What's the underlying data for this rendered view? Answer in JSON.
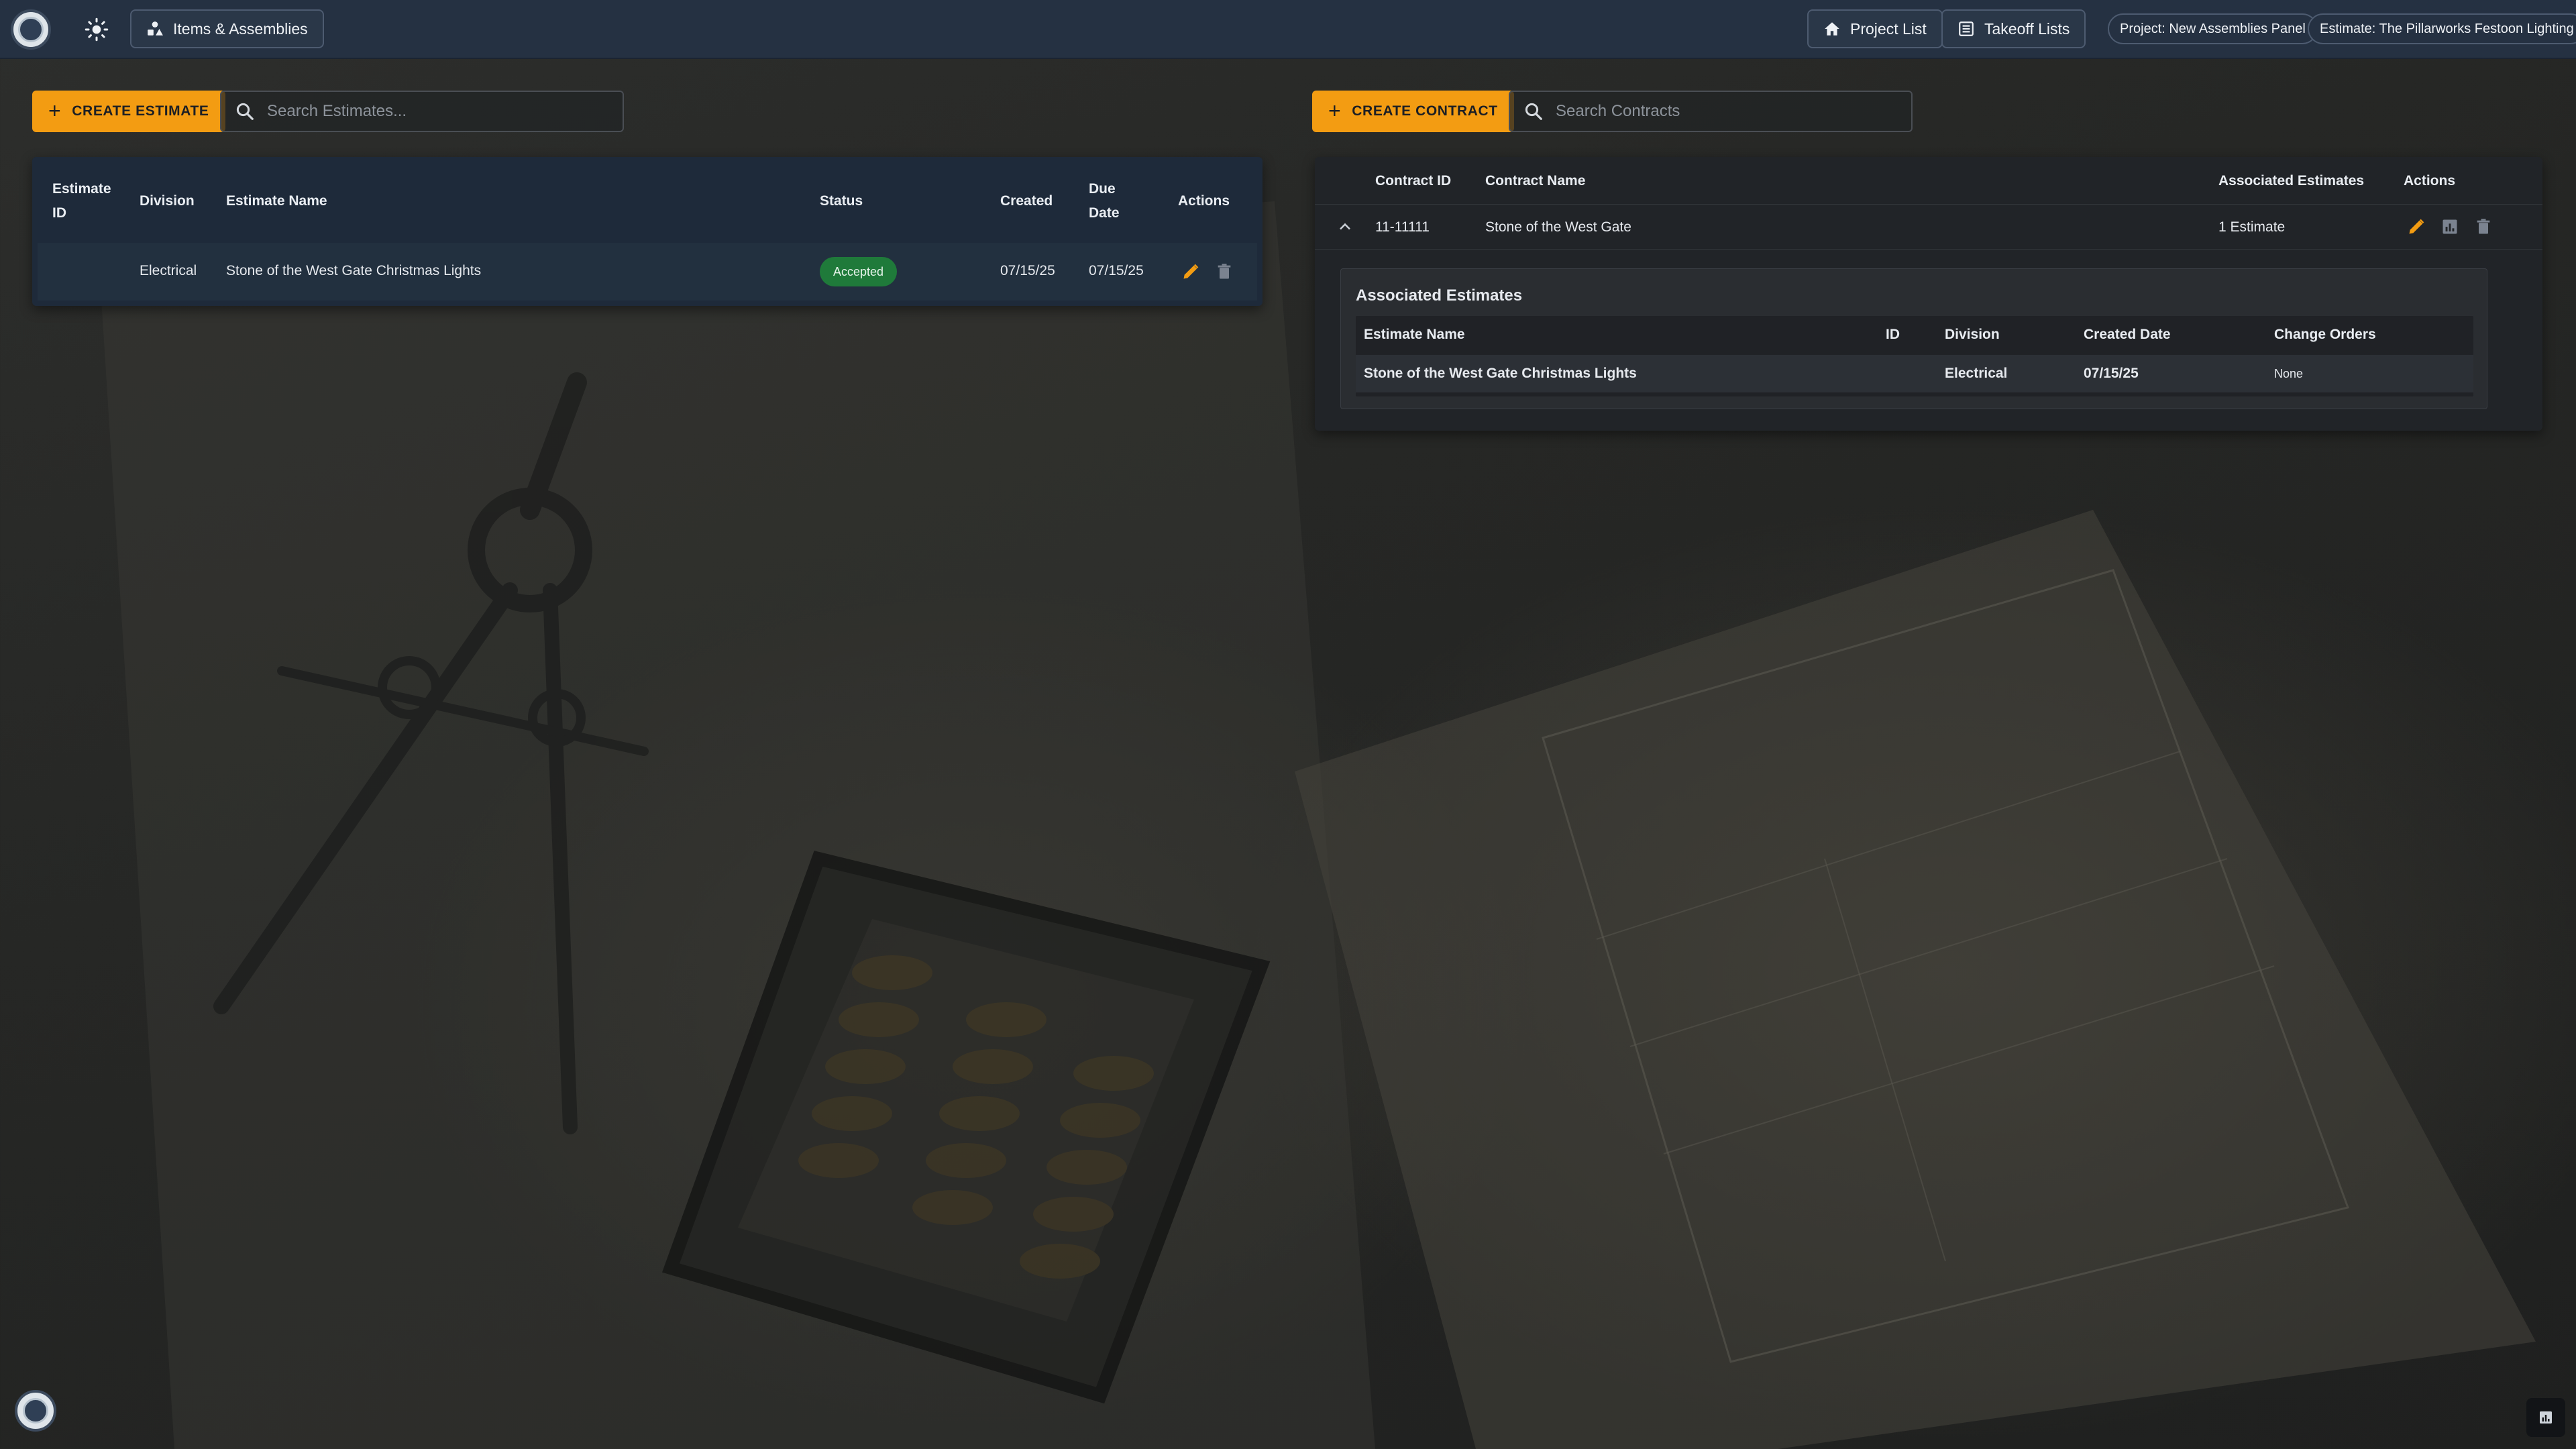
{
  "topbar": {
    "items_assemblies_label": "Items & Assemblies",
    "project_list_label": "Project List",
    "takeoff_lists_label": "Takeoff Lists",
    "project_pill": "Project: New Assemblies Panel",
    "estimate_pill": "Estimate: The Pillarworks Festoon Lighting"
  },
  "estimates": {
    "create_label": "CREATE ESTIMATE",
    "search_placeholder": "Search Estimates...",
    "headers": {
      "estimate_id_1": "Estimate",
      "estimate_id_2": "ID",
      "division": "Division",
      "estimate_name": "Estimate Name",
      "status": "Status",
      "created": "Created",
      "due_date_1": "Due",
      "due_date_2": "Date",
      "actions": "Actions"
    },
    "rows": [
      {
        "estimate_id": "",
        "division": "Electrical",
        "estimate_name": "Stone of the West Gate Christmas Lights",
        "status": "Accepted",
        "created": "07/15/25",
        "due_date": "07/15/25"
      }
    ]
  },
  "contracts": {
    "create_label": "CREATE CONTRACT",
    "search_placeholder": "Search Contracts",
    "headers": {
      "contract_id": "Contract ID",
      "contract_name": "Contract Name",
      "associated_estimates": "Associated Estimates",
      "actions": "Actions"
    },
    "rows": [
      {
        "contract_id": "11-11111",
        "contract_name": "Stone of the West Gate",
        "associated_estimates": "1 Estimate",
        "expanded": true
      }
    ],
    "associated": {
      "title": "Associated Estimates",
      "headers": {
        "estimate_name": "Estimate Name",
        "id": "ID",
        "division": "Division",
        "created_date": "Created Date",
        "change_orders": "Change Orders"
      },
      "rows": [
        {
          "estimate_name": "Stone of the West Gate Christmas Lights",
          "id": "",
          "division": "Electrical",
          "created_date": "07/15/25",
          "change_orders": "None"
        }
      ]
    }
  },
  "colors": {
    "accent": "#f39c12",
    "topbar": "#253142",
    "panel": "#1e2a3a",
    "status_accepted": "#1f7a3a"
  },
  "icons": [
    "logo-icon",
    "sun-icon",
    "assemblies-icon",
    "home-icon",
    "list-icon",
    "plus-icon",
    "search-icon",
    "chevron-up-icon",
    "pencil-icon",
    "trash-icon",
    "chart-icon"
  ]
}
